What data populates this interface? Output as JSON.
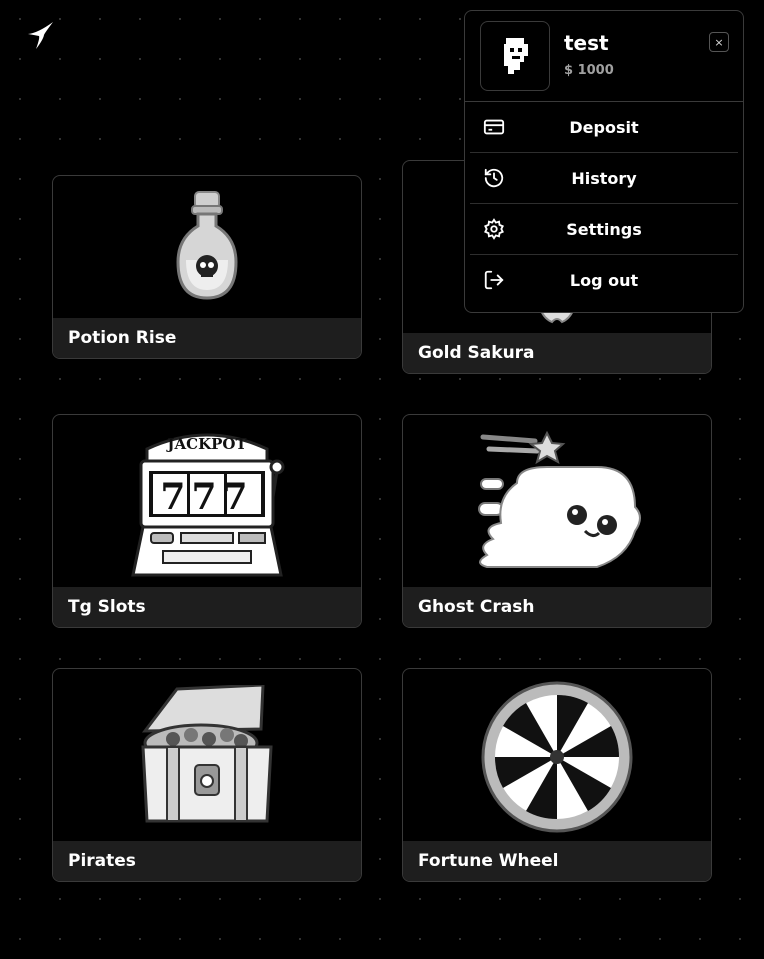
{
  "header": {
    "logo_icon": "sparkle-logo-icon"
  },
  "games": [
    {
      "title": "Potion Rise",
      "icon": "potion-bottle-icon"
    },
    {
      "title": "Gold Sakura",
      "icon": "sakura-icon"
    },
    {
      "title": "Tg Slots",
      "icon": "slot-machine-icon",
      "art_text": "JACKPOT",
      "reels": "777"
    },
    {
      "title": "Ghost Crash",
      "icon": "ghost-icon"
    },
    {
      "title": "Pirates",
      "icon": "treasure-chest-icon"
    },
    {
      "title": "Fortune Wheel",
      "icon": "fortune-wheel-icon"
    }
  ],
  "profile_menu": {
    "username": "test",
    "balance": "$ 1000",
    "close_label": "×",
    "items": [
      {
        "label": "Deposit",
        "icon": "card-icon"
      },
      {
        "label": "History",
        "icon": "history-icon"
      },
      {
        "label": "Settings",
        "icon": "gear-icon"
      },
      {
        "label": "Log out",
        "icon": "logout-icon"
      }
    ]
  },
  "colors": {
    "background": "#000000",
    "card_border": "#3a3a3a",
    "title_bar": "#1e1e1e",
    "muted_text": "#a0a0a0"
  }
}
